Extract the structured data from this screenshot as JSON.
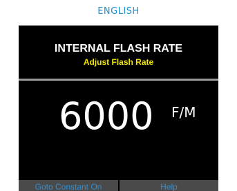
{
  "language_label": "ENGLISH",
  "screen": {
    "title": "INTERNAL FLASH RATE",
    "subtitle": "Adjust Flash Rate"
  },
  "rate": {
    "value": "6000",
    "unit": "F/M"
  },
  "softkeys": {
    "left_label": "Goto Constant On",
    "right_label": "Help"
  },
  "colors": {
    "language_label": "#1e8fd0",
    "screen_background": "#000000",
    "subtitle": "#f2e600",
    "softkey_text": "#2d8fd4",
    "softkey_background": "#4a4a4a"
  }
}
